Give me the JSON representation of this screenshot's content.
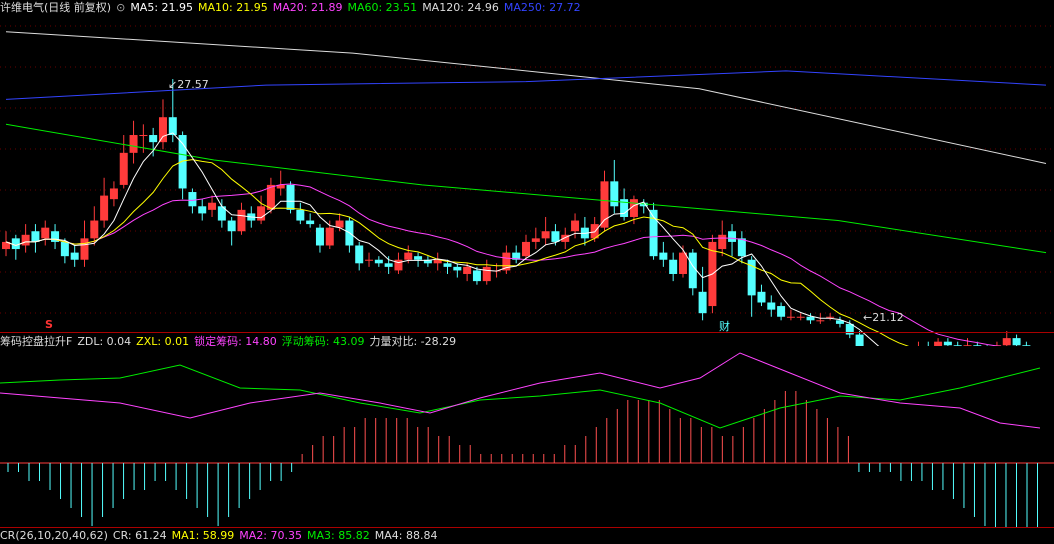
{
  "main": {
    "stock_title": "许维电气(日线 前复权)",
    "ma_legend": [
      {
        "label": "MA5: 21.95",
        "color": "#ffffff"
      },
      {
        "label": "MA10: 21.95",
        "color": "#ffff00"
      },
      {
        "label": "MA20: 21.89",
        "color": "#ff44ff"
      },
      {
        "label": "MA60: 23.51",
        "color": "#00ee00"
      },
      {
        "label": "MA120: 24.96",
        "color": "#dddddd"
      },
      {
        "label": "MA250: 27.72",
        "color": "#3344ff"
      }
    ],
    "high_marker": "27.57",
    "low_marker": "21.12",
    "signal_s": "S",
    "signal_cai": "财",
    "colors": {
      "up": "#ff3b3b",
      "down": "#54ffff",
      "bg": "#000000"
    }
  },
  "chip": {
    "title": "筹码控盘拉升F",
    "items": [
      {
        "label": "ZDL: 0.04",
        "color": "#dddddd"
      },
      {
        "label": "ZXL: 0.01",
        "color": "#ffff00"
      },
      {
        "label": "锁定筹码: 14.80",
        "color": "#ff44ff"
      },
      {
        "label": "浮动筹码: 43.09",
        "color": "#00ee00"
      },
      {
        "label": "力量对比: -28.29",
        "color": "#dddddd"
      }
    ]
  },
  "cr": {
    "items": [
      {
        "label": "CR(26,10,20,40,62)",
        "color": "#dddddd"
      },
      {
        "label": "CR: 61.24",
        "color": "#dddddd"
      },
      {
        "label": "MA1: 58.99",
        "color": "#ffff00"
      },
      {
        "label": "MA2: 70.35",
        "color": "#ff44ff"
      },
      {
        "label": "MA3: 85.82",
        "color": "#00ee00"
      },
      {
        "label": "MA4: 88.84",
        "color": "#dddddd"
      }
    ]
  },
  "chart_data": {
    "type": "candlestick",
    "price_range": [
      20.5,
      29.2
    ],
    "candles": [
      [
        22.8,
        23.0,
        23.3,
        22.6
      ],
      [
        23.1,
        22.8,
        23.2,
        22.5
      ],
      [
        22.9,
        23.2,
        23.5,
        22.7
      ],
      [
        23.3,
        23.0,
        23.5,
        22.7
      ],
      [
        23.1,
        23.4,
        23.6,
        22.9
      ],
      [
        23.3,
        23.0,
        23.5,
        22.8
      ],
      [
        23.0,
        22.6,
        23.1,
        22.4
      ],
      [
        22.7,
        22.5,
        22.9,
        22.3
      ],
      [
        22.5,
        23.1,
        23.6,
        22.3
      ],
      [
        23.1,
        23.6,
        24.0,
        22.9
      ],
      [
        23.6,
        24.3,
        24.8,
        23.4
      ],
      [
        24.2,
        24.5,
        24.7,
        24.0
      ],
      [
        24.6,
        25.5,
        26.0,
        24.5
      ],
      [
        25.5,
        26.0,
        26.4,
        25.2
      ],
      [
        26.0,
        26.0,
        26.3,
        25.5
      ],
      [
        26.0,
        25.8,
        26.2,
        25.4
      ],
      [
        25.8,
        26.5,
        27.0,
        25.6
      ],
      [
        26.5,
        26.0,
        27.57,
        25.8
      ],
      [
        26.0,
        24.5,
        26.1,
        24.2
      ],
      [
        24.4,
        24.0,
        24.5,
        23.8
      ],
      [
        24.0,
        23.8,
        24.2,
        23.6
      ],
      [
        23.9,
        24.1,
        24.3,
        23.7
      ],
      [
        24.0,
        23.6,
        24.2,
        23.4
      ],
      [
        23.6,
        23.3,
        23.7,
        22.9
      ],
      [
        23.3,
        23.9,
        24.1,
        23.2
      ],
      [
        23.8,
        23.6,
        24.0,
        23.4
      ],
      [
        23.6,
        24.0,
        24.3,
        23.5
      ],
      [
        23.9,
        24.6,
        24.8,
        23.8
      ],
      [
        24.5,
        24.6,
        25.0,
        24.3
      ],
      [
        24.6,
        23.9,
        24.7,
        23.8
      ],
      [
        23.9,
        23.6,
        24.1,
        23.5
      ],
      [
        23.6,
        23.5,
        23.8,
        23.4
      ],
      [
        23.4,
        22.9,
        23.5,
        22.7
      ],
      [
        22.9,
        23.4,
        23.6,
        22.8
      ],
      [
        23.4,
        23.6,
        23.8,
        23.3
      ],
      [
        23.6,
        22.9,
        23.7,
        22.7
      ],
      [
        22.9,
        22.4,
        23.0,
        22.2
      ],
      [
        22.5,
        22.5,
        22.7,
        22.3
      ],
      [
        22.5,
        22.4,
        22.6,
        22.3
      ],
      [
        22.4,
        22.3,
        22.6,
        22.1
      ],
      [
        22.2,
        22.5,
        22.7,
        22.1
      ],
      [
        22.5,
        22.7,
        22.9,
        22.4
      ],
      [
        22.6,
        22.5,
        22.7,
        22.3
      ],
      [
        22.5,
        22.4,
        22.6,
        22.3
      ],
      [
        22.4,
        22.5,
        22.7,
        22.2
      ],
      [
        22.4,
        22.3,
        22.5,
        22.1
      ],
      [
        22.3,
        22.2,
        22.4,
        22.0
      ],
      [
        22.1,
        22.3,
        22.4,
        21.9
      ],
      [
        22.2,
        21.9,
        22.3,
        21.8
      ],
      [
        21.9,
        22.3,
        22.5,
        21.8
      ],
      [
        22.2,
        22.2,
        22.4,
        22.0
      ],
      [
        22.2,
        22.7,
        22.9,
        22.1
      ],
      [
        22.7,
        22.5,
        22.9,
        22.4
      ],
      [
        22.6,
        23.0,
        23.2,
        22.5
      ],
      [
        23.0,
        23.1,
        23.4,
        22.8
      ],
      [
        23.1,
        23.3,
        23.7,
        22.9
      ],
      [
        23.3,
        23.0,
        23.5,
        22.9
      ],
      [
        23.0,
        23.2,
        23.4,
        22.8
      ],
      [
        23.3,
        23.6,
        23.8,
        23.1
      ],
      [
        23.4,
        23.1,
        23.7,
        22.9
      ],
      [
        23.1,
        23.5,
        23.7,
        23.0
      ],
      [
        23.4,
        24.7,
        25.0,
        23.3
      ],
      [
        24.7,
        24.0,
        25.3,
        23.8
      ],
      [
        24.2,
        23.7,
        24.5,
        23.6
      ],
      [
        23.7,
        24.2,
        24.3,
        23.5
      ],
      [
        24.1,
        24.0,
        24.2,
        23.8
      ],
      [
        23.9,
        22.6,
        24.1,
        22.5
      ],
      [
        22.7,
        22.5,
        23.0,
        22.3
      ],
      [
        22.5,
        22.1,
        22.7,
        21.9
      ],
      [
        22.1,
        22.7,
        22.9,
        22.0
      ],
      [
        22.7,
        21.7,
        22.8,
        21.5
      ],
      [
        21.6,
        21.0,
        22.3,
        20.8
      ],
      [
        21.2,
        23.0,
        23.2,
        21.0
      ],
      [
        22.8,
        23.2,
        23.6,
        22.6
      ],
      [
        23.3,
        23.0,
        23.5,
        22.6
      ],
      [
        23.1,
        22.6,
        23.3,
        22.4
      ],
      [
        22.5,
        21.5,
        22.6,
        20.9
      ],
      [
        21.6,
        21.3,
        21.8,
        21.2
      ],
      [
        21.3,
        21.1,
        21.5,
        20.9
      ],
      [
        21.2,
        20.9,
        21.3,
        20.8
      ],
      [
        20.9,
        20.9,
        21.1,
        20.8
      ],
      [
        20.9,
        20.9,
        21.0,
        20.8
      ],
      [
        20.9,
        20.8,
        21.0,
        20.7
      ],
      [
        20.8,
        20.8,
        21.0,
        20.7
      ],
      [
        20.9,
        20.9,
        21.0,
        20.8
      ],
      [
        20.8,
        20.7,
        20.9,
        20.6
      ],
      [
        20.7,
        20.4,
        20.8,
        20.3
      ],
      [
        20.4,
        19.9,
        20.5,
        19.6
      ],
      [
        19.9,
        19.6,
        20.0,
        19.5
      ],
      [
        19.5,
        19.7,
        19.8,
        19.4
      ],
      [
        19.7,
        19.3,
        19.9,
        19.2
      ],
      [
        19.3,
        19.6,
        19.8,
        19.12
      ],
      [
        19.6,
        19.8,
        20.0,
        19.4
      ],
      [
        19.8,
        20.0,
        20.2,
        19.7
      ],
      [
        20.0,
        19.9,
        20.2,
        19.8
      ],
      [
        19.9,
        20.2,
        20.3,
        19.8
      ],
      [
        20.2,
        20.1,
        20.3,
        19.9
      ],
      [
        20.1,
        19.9,
        20.2,
        19.8
      ],
      [
        20.0,
        20.1,
        20.3,
        19.9
      ],
      [
        20.1,
        20.0,
        20.2,
        19.9
      ],
      [
        20.0,
        19.8,
        20.1,
        19.7
      ],
      [
        19.8,
        20.1,
        20.2,
        19.7
      ],
      [
        20.1,
        20.3,
        20.5,
        20.0
      ],
      [
        20.3,
        20.1,
        20.4,
        19.9
      ],
      [
        20.1,
        19.8,
        20.2,
        19.7
      ],
      [
        19.8,
        19.9,
        20.0,
        19.6
      ]
    ],
    "ma_lines": [
      {
        "name": "MA120",
        "color": "#dddddd",
        "values": [
          28.9,
          28.3,
          27.3,
          25.2
        ]
      },
      {
        "name": "MA250",
        "color": "#3344ff",
        "values": [
          27.0,
          27.4,
          27.5,
          27.8,
          27.4
        ]
      },
      {
        "name": "MA60",
        "color": "#00ee00",
        "values": [
          26.3,
          25.3,
          24.6,
          24.1,
          23.6,
          22.7
        ]
      }
    ],
    "chip_histogram": [
      -1,
      -1,
      -2,
      -2,
      -3,
      -4,
      -5,
      -6,
      -7,
      -6,
      -5,
      -4,
      -3,
      -3,
      -2,
      -2,
      -3,
      -4,
      -5,
      -6,
      -7,
      -6,
      -5,
      -4,
      -3,
      -2,
      -2,
      -1,
      1,
      2,
      3,
      3,
      4,
      4,
      5,
      5,
      5,
      5,
      5,
      4,
      4,
      3,
      3,
      2,
      2,
      1,
      1,
      1,
      1,
      1,
      1,
      1,
      1,
      2,
      2,
      3,
      4,
      5,
      6,
      7,
      7,
      7,
      7,
      6,
      5,
      5,
      4,
      4,
      3,
      3,
      4,
      5,
      6,
      7,
      8,
      8,
      7,
      6,
      5,
      4,
      3,
      -1,
      -1,
      -1,
      -1,
      -2,
      -2,
      -2,
      -3,
      -3,
      -4,
      -5,
      -6,
      -7,
      -8,
      -8,
      -9,
      -10,
      -12
    ]
  }
}
